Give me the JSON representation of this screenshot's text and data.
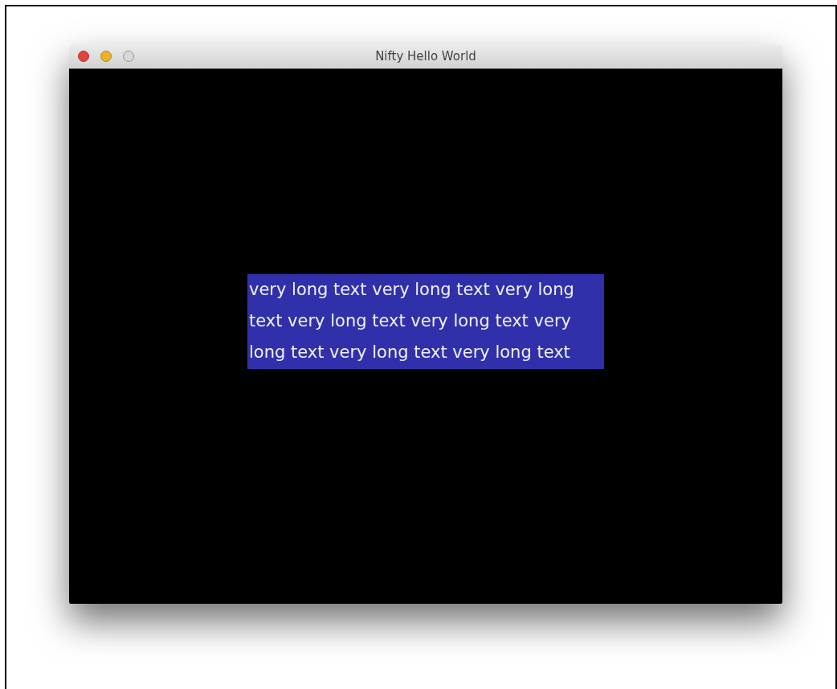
{
  "window": {
    "title": "Nifty Hello World"
  },
  "panel": {
    "text": "very long text very long text very long text very long text very long text very long text very long text very long text"
  }
}
